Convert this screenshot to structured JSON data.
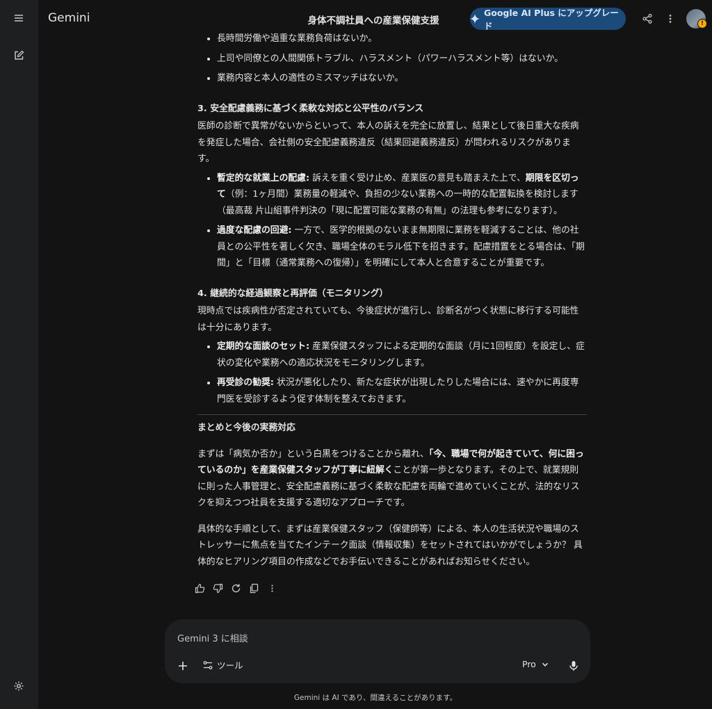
{
  "app": {
    "brand": "Gemini"
  },
  "header": {
    "chat_title": "身体不調社員への産業保健支援",
    "upgrade_label": "Google AI Plus にアップグレード"
  },
  "sidebar": {
    "items": [
      {
        "icon": "menu-icon"
      },
      {
        "icon": "new-chat-icon"
      },
      {
        "icon": "settings-icon"
      }
    ]
  },
  "response": {
    "top_bullets": [
      "長時間労働や過重な業務負荷はないか。",
      "上司や同僚との人間関係トラブル、ハラスメント（パワーハラスメント等）はないか。",
      "業務内容と本人の適性のミスマッチはないか。"
    ],
    "s3": {
      "heading": "3. 安全配慮義務に基づく柔軟な対応と公平性のバランス",
      "paragraph": "医師の診断で異常がないからといって、本人の訴えを完全に放置し、結果として後日重大な疾病を発症した場合、会社側の安全配慮義務違反（結果回避義務違反）が問われるリスクがあります。",
      "b1_label": "暫定的な就業上の配慮:",
      "b1_text1": " 訴えを重く受け止め、産業医の意見も踏まえた上で、",
      "b1_bold": "期限を区切って",
      "b1_text2": "（例：1ヶ月間）業務量の軽減や、負担の少ない業務への一時的な配置転換を検討します（最高裁 片山組事件判決の「現に配置可能な業務の有無」の法理も参考になります）。",
      "b2_label": "過度な配慮の回避:",
      "b2_text": " 一方で、医学的根拠のないまま無期限に業務を軽減することは、他の社員との公平性を著しく欠き、職場全体のモラル低下を招きます。配慮措置をとる場合は、「期間」と「目標（通常業務への復帰）」を明確にして本人と合意することが重要です。"
    },
    "s4": {
      "heading": "4. 継続的な経過観察と再評価（モニタリング）",
      "paragraph": "現時点では疾病性が否定されていても、今後症状が進行し、診断名がつく状態に移行する可能性は十分にあります。",
      "b1_label": "定期的な面談のセット:",
      "b1_text": " 産業保健スタッフによる定期的な面談（月に1回程度）を設定し、症状の変化や業務への適応状況をモニタリングします。",
      "b2_label": "再受診の勧奨:",
      "b2_text": " 状況が悪化したり、新たな症状が出現したりした場合には、速やかに再度専門医を受診するよう促す体制を整えておきます。"
    },
    "summary": {
      "heading": "まとめと今後の実務対応",
      "p1_a": "まずは「病気か否か」という白黒をつけることから離れ、",
      "p1_bold": "「今、職場で何が起きていて、何に困っているのか」を産業保健スタッフが丁寧に紐解く",
      "p1_b": "ことが第一歩となります。その上で、就業規則に則った人事管理と、安全配慮義務に基づく柔軟な配慮を両輪で進めていくことが、法的なリスクを抑えつつ社員を支援する適切なアプローチです。",
      "p2": "具体的な手順として、まずは産業保健スタッフ（保健師等）による、本人の生活状況や職場のストレッサーに焦点を当てたインテーク面談（情報収集）をセットされてはいかがでしょうか？ 具体的なヒアリング項目の作成などでお手伝いできることがあればお知らせください。"
    }
  },
  "input": {
    "placeholder": "Gemini 3 に相談",
    "tools_label": "ツール",
    "model_label": "Pro"
  },
  "footer": {
    "disclaimer": "Gemini は AI であり、間違えることがあります。"
  },
  "colors": {
    "background": "#131314",
    "rail": "#1e1f20",
    "upgrade_bg": "#1b4b7a",
    "text": "#e3e3e3"
  }
}
